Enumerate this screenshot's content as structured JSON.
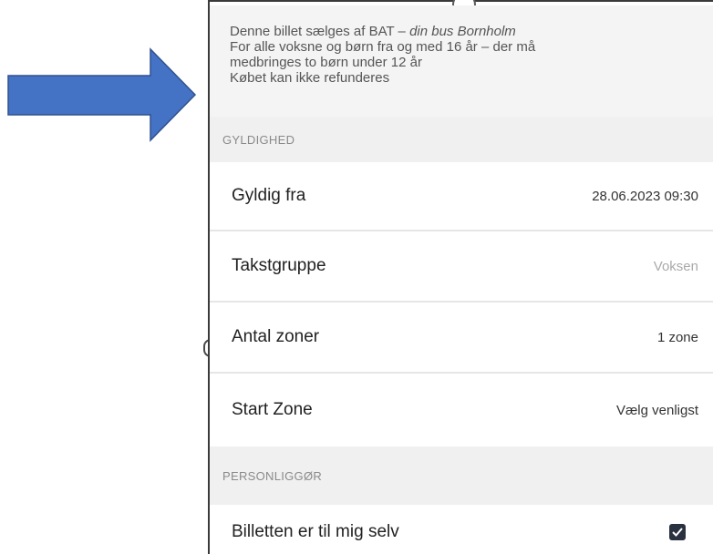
{
  "info": {
    "line1_prefix": "Denne billet sælges af BAT – ",
    "line1_italic": "din bus Bornholm",
    "line2": "For alle voksne og børn fra og med 16 år – der må",
    "line3": "medbringes to børn under 12 år",
    "line4": "Købet kan ikke refunderes"
  },
  "sections": {
    "validity_header": "GYLDIGHED",
    "personal_header": "PERSONLIGGØR"
  },
  "rows": {
    "valid_from": {
      "label": "Gyldig fra",
      "value": "28.06.2023 09:30"
    },
    "fare_group": {
      "label": "Takstgruppe",
      "value": "Voksen"
    },
    "zones": {
      "label": "Antal zoner",
      "value": "1 zone"
    },
    "start_zone": {
      "label": "Start Zone",
      "value": "Vælg venligst"
    },
    "for_me": {
      "label": "Billetten er til mig selv",
      "checked": true
    }
  },
  "colors": {
    "arrow_fill": "#4472c4",
    "arrow_stroke": "#2f528f",
    "checkbox": "#2a3140"
  },
  "icons": {
    "arrow": "right-arrow-icon",
    "checkbox": "checkbox-checked-icon"
  }
}
